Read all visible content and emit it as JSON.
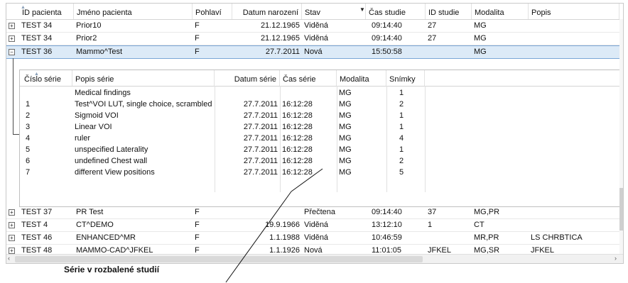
{
  "columns": [
    "ID pacienta",
    "Jméno pacienta",
    "Pohlaví",
    "Datum narození",
    "Stav",
    "Čas studie",
    "ID studie",
    "Modalita",
    "Popis"
  ],
  "rows_top": [
    {
      "expander": "+",
      "id": "TEST 34",
      "name": "Prior10",
      "sex": "F",
      "dob": "21.12.1965",
      "status": "Viděná",
      "time": "09:14:40",
      "study_id": "27",
      "modality": "MG",
      "desc": ""
    },
    {
      "expander": "+",
      "id": "TEST 34",
      "name": "Prior2",
      "sex": "F",
      "dob": "21.12.1965",
      "status": "Viděná",
      "time": "09:14:40",
      "study_id": "27",
      "modality": "MG",
      "desc": ""
    },
    {
      "expander": "−",
      "id": "TEST 36",
      "name": "Mammo^Test",
      "sex": "F",
      "dob": "27.7.2011",
      "status": "Nová",
      "time": "15:50:58",
      "study_id": "",
      "modality": "MG",
      "desc": ""
    }
  ],
  "series_columns": [
    "Číslo série",
    "Popis série",
    "Datum série",
    "Čas série",
    "Modalita",
    "Snímky"
  ],
  "series": [
    {
      "num": "",
      "desc": "Medical findings",
      "date": "",
      "time": "",
      "modality": "MG",
      "images": "1"
    },
    {
      "num": "1",
      "desc": "Test^VOI LUT, single choice, scrambled",
      "date": "27.7.2011",
      "time": "16:12:28",
      "modality": "MG",
      "images": "2"
    },
    {
      "num": "2",
      "desc": "Sigmoid VOI",
      "date": "27.7.2011",
      "time": "16:12:28",
      "modality": "MG",
      "images": "1"
    },
    {
      "num": "3",
      "desc": "Linear VOI",
      "date": "27.7.2011",
      "time": "16:12:28",
      "modality": "MG",
      "images": "1"
    },
    {
      "num": "4",
      "desc": "ruler",
      "date": "27.7.2011",
      "time": "16:12:28",
      "modality": "MG",
      "images": "4"
    },
    {
      "num": "5",
      "desc": "unspecified Laterality",
      "date": "27.7.2011",
      "time": "16:12:28",
      "modality": "MG",
      "images": "1"
    },
    {
      "num": "6",
      "desc": "undefined Chest wall",
      "date": "27.7.2011",
      "time": "16:12:28",
      "modality": "MG",
      "images": "2"
    },
    {
      "num": "7",
      "desc": "different View positions",
      "date": "27.7.2011",
      "time": "16:12:28",
      "modality": "MG",
      "images": "5"
    }
  ],
  "rows_bottom": [
    {
      "expander": "+",
      "id": "TEST 37",
      "name": "PR Test",
      "sex": "F",
      "dob": "",
      "status": "Přečtena",
      "time": "09:14:40",
      "study_id": "37",
      "modality": "MG,PR",
      "desc": ""
    },
    {
      "expander": "+",
      "id": "TEST 4",
      "name": "CT^DEMO",
      "sex": "F",
      "dob": "19.9.1966",
      "status": "Viděná",
      "time": "13:12:10",
      "study_id": "1",
      "modality": "CT",
      "desc": ""
    },
    {
      "expander": "+",
      "id": "TEST 46",
      "name": "ENHANCED^MR",
      "sex": "F",
      "dob": "1.1.1988",
      "status": "Viděná",
      "time": "10:46:59",
      "study_id": "",
      "modality": "MR,PR",
      "desc": "LS CHRBTICA"
    },
    {
      "expander": "+",
      "id": "TEST 48",
      "name": "MAMMO-CAD^JFKEL",
      "sex": "F",
      "dob": "1.1.1926",
      "status": "Nová",
      "time": "11:01:05",
      "study_id": "JFKEL",
      "modality": "MG,SR",
      "desc": "JFKEL"
    }
  ],
  "annotation": "Série v rozbalené studií",
  "icons": {
    "sort": "sort-asc-icon",
    "filter": "filter-dropdown-icon",
    "expand": "plus-box-icon",
    "collapse": "minus-box-icon"
  },
  "colors": {
    "selected_row": "#dceaf7",
    "selected_border": "#7aa6d6",
    "grid_line": "#e8e8e8"
  }
}
